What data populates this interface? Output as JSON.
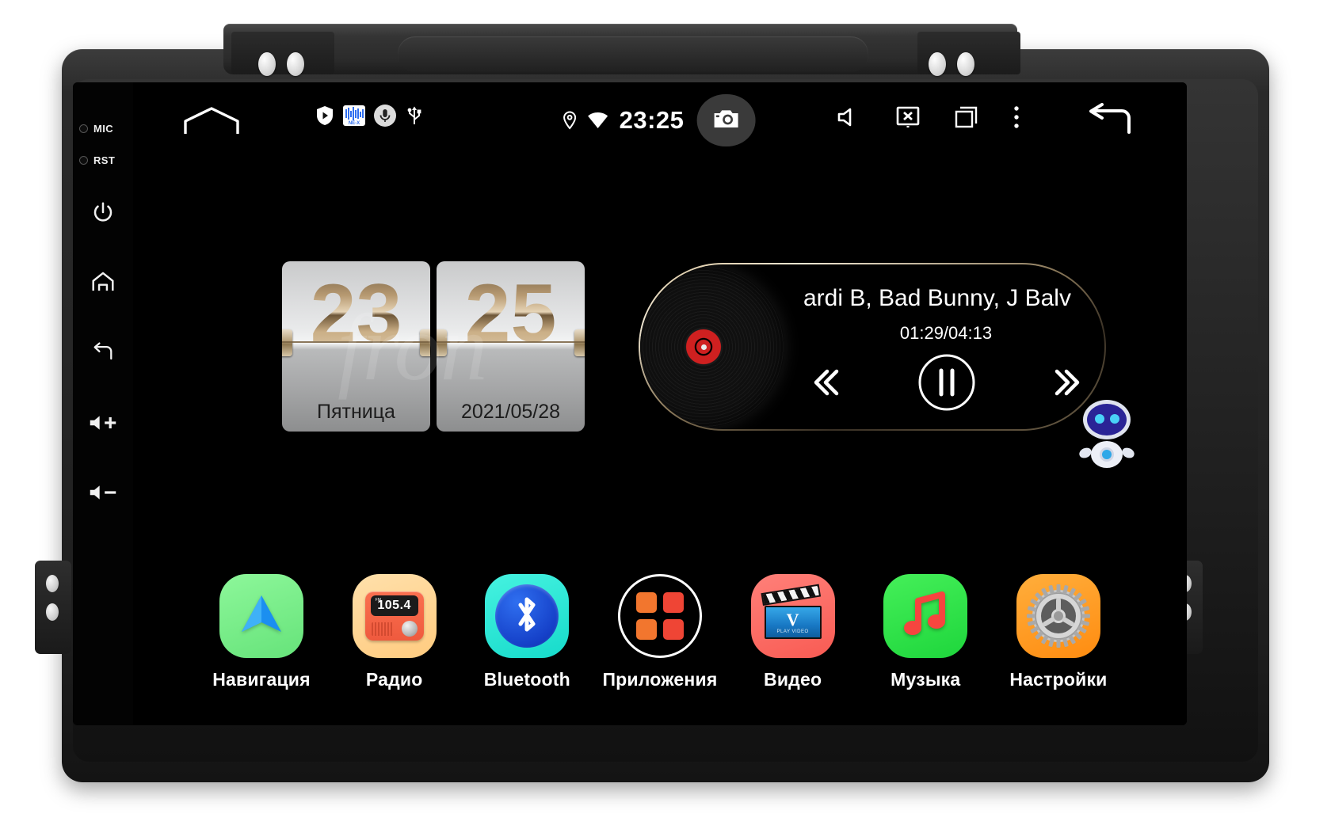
{
  "device": {
    "type": "android-car-head-unit",
    "frame_color": "#262626"
  },
  "hardware": {
    "indicators": [
      {
        "name": "mic-indicator",
        "label": "MIC"
      },
      {
        "name": "rst-indicator",
        "label": "RST"
      }
    ],
    "side_keys": [
      {
        "name": "power-key",
        "icon": "power-icon"
      },
      {
        "name": "home-key",
        "icon": "home-icon"
      },
      {
        "name": "back-key",
        "icon": "back-arrow-icon"
      },
      {
        "name": "volume-up-key",
        "icon": "volume-up-icon"
      },
      {
        "name": "volume-down-key",
        "icon": "volume-down-icon"
      }
    ]
  },
  "statusbar": {
    "home_icon": "home-outline-icon",
    "left_icons": [
      {
        "name": "shield-play-icon",
        "label": "shield-play"
      },
      {
        "name": "equalizer-icon",
        "label": "equalizer",
        "caption": "NE-X"
      },
      {
        "name": "microphone-icon",
        "label": "microphone"
      },
      {
        "name": "usb-icon",
        "label": "usb"
      }
    ],
    "location_icon": "location-pin-icon",
    "wifi_icon": "wifi-icon",
    "clock": "23:25",
    "camera_icon": "camera-icon",
    "camera_highlighted": true,
    "right_icons": [
      {
        "name": "volume-icon",
        "label": "volume"
      },
      {
        "name": "screen-off-icon",
        "label": "screen-off"
      },
      {
        "name": "recents-icon",
        "label": "recents"
      },
      {
        "name": "overflow-menu-icon",
        "label": "more"
      }
    ],
    "back_icon": "back-arrow-icon"
  },
  "clock_widget": {
    "hours": "23",
    "minutes": "25",
    "weekday": "Пятница",
    "date": "2021/05/28",
    "watermark": "fron"
  },
  "music_widget": {
    "track": "ardi B, Bad Bunny, J Balv",
    "time_elapsed": "01:29",
    "time_total": "04:13",
    "time_display": "01:29/04:13",
    "prev_icon": "previous-track-icon",
    "play_pause_icon": "pause-icon",
    "next_icon": "next-track-icon",
    "album_art": "vinyl-record"
  },
  "assistant": {
    "name": "robot-assistant",
    "accent": "#3a35c8"
  },
  "dock": {
    "apps": [
      {
        "id": "navigation",
        "label": "Навигация",
        "icon": "navigation-arrow-icon",
        "bg": "#7cf08a",
        "accent": "#1e8fe8"
      },
      {
        "id": "radio",
        "label": "Радио",
        "icon": "radio-icon",
        "bg": "#ffd694",
        "accent": "#f4603f",
        "frequency": "105.4",
        "band": "FM"
      },
      {
        "id": "bluetooth",
        "label": "Bluetooth",
        "icon": "bluetooth-icon",
        "bg": "#2ae8d8",
        "accent": "#1540c8"
      },
      {
        "id": "apps",
        "label": "Приложения",
        "icon": "apps-grid-icon",
        "bg": "#000000",
        "accent": "#f0582e"
      },
      {
        "id": "video",
        "label": "Видео",
        "icon": "video-clapperboard-icon",
        "bg": "#fa6b63",
        "accent": "#1878c4",
        "caption": "PLAY VIDEO"
      },
      {
        "id": "music",
        "label": "Музыка",
        "icon": "music-note-icon",
        "bg": "#2bdd46",
        "accent": "#f23a38"
      },
      {
        "id": "settings",
        "label": "Настройки",
        "icon": "gear-icon",
        "bg": "#ff9d22",
        "accent": "#b9b9b9"
      }
    ]
  }
}
